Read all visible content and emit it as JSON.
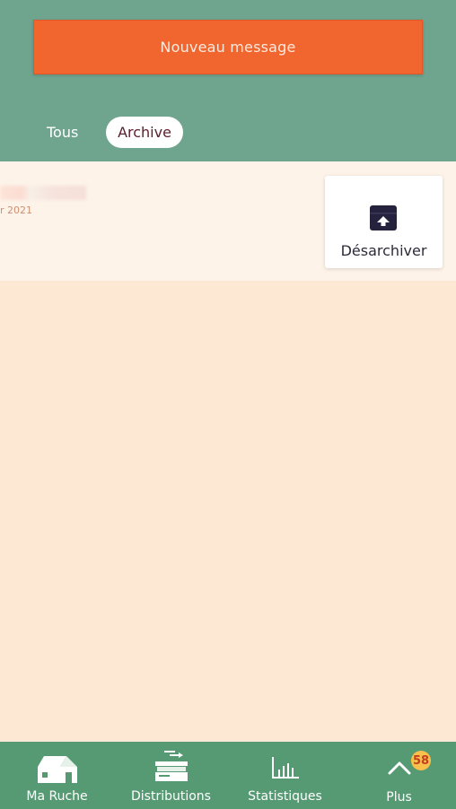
{
  "header": {
    "new_message_label": "Nouveau message",
    "tabs": [
      {
        "label": "Tous",
        "active": false
      },
      {
        "label": "Archive",
        "active": true
      }
    ]
  },
  "message": {
    "date_fragment": "r 2021",
    "action_label": "Désarchiver",
    "action_icon": "unarchive-icon"
  },
  "bottom_nav": {
    "items": [
      {
        "label": "Ma Ruche",
        "icon": "house-icon"
      },
      {
        "label": "Distributions",
        "icon": "distribution-icon"
      },
      {
        "label": "Statistiques",
        "icon": "bar-chart-icon"
      },
      {
        "label": "Plus",
        "icon": "chevron-up-icon",
        "badge": "58"
      }
    ]
  },
  "colors": {
    "header_bg": "#6fa48f",
    "accent": "#f1652f",
    "nav_bg": "#569a74",
    "content_bg": "#fce8d3",
    "badge": "#f9c04c"
  }
}
